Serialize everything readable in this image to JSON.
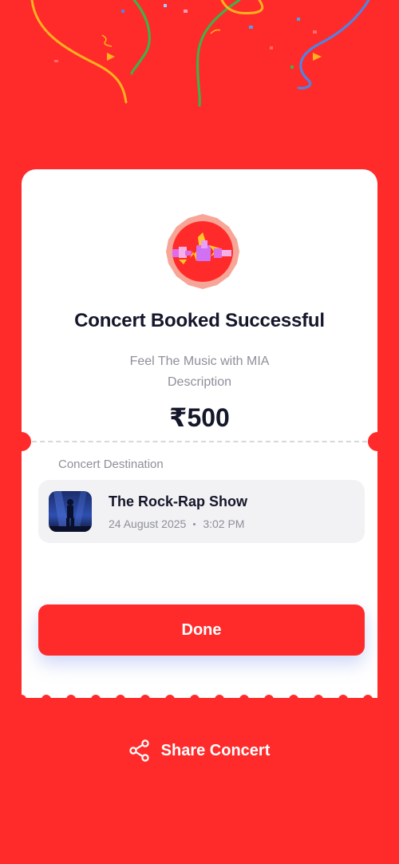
{
  "success": {
    "title": "Concert Booked Successful",
    "subtitle_line1": "Feel The Music with MIA",
    "subtitle_line2": "Description",
    "price": "₹500"
  },
  "destination": {
    "label": "Concert Destination",
    "concert_name": "The Rock-Rap Show",
    "date": "24 August 2025",
    "time": "3:02 PM"
  },
  "actions": {
    "done_label": "Done",
    "share_label": "Share Concert"
  },
  "colors": {
    "accent": "#FF2B2B",
    "text_primary": "#14162A",
    "text_secondary": "#8E8F9A",
    "card_background": "#F2F2F4"
  },
  "icons": {
    "badge": "music-waveform-icon",
    "share": "share-icon"
  }
}
